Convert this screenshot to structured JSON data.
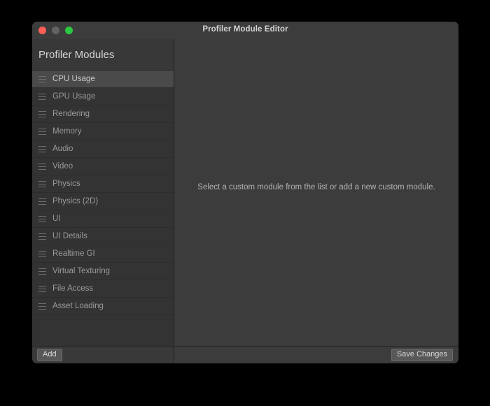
{
  "window": {
    "title": "Profiler Module Editor",
    "traffic_lights": [
      {
        "name": "close",
        "color": "#ff5f57"
      },
      {
        "name": "minimize",
        "color": "#636363"
      },
      {
        "name": "zoom",
        "color": "#28c840"
      }
    ]
  },
  "sidebar": {
    "header": "Profiler Modules",
    "selected_index": 0,
    "items": [
      {
        "label": "CPU Usage",
        "handle_icon": "drag-handle-icon",
        "selected": true
      },
      {
        "label": "GPU Usage",
        "handle_icon": "drag-handle-icon",
        "selected": false
      },
      {
        "label": "Rendering",
        "handle_icon": "drag-handle-icon",
        "selected": false
      },
      {
        "label": "Memory",
        "handle_icon": "drag-handle-icon",
        "selected": false
      },
      {
        "label": "Audio",
        "handle_icon": "drag-handle-icon",
        "selected": false
      },
      {
        "label": "Video",
        "handle_icon": "drag-handle-icon",
        "selected": false
      },
      {
        "label": "Physics",
        "handle_icon": "drag-handle-icon",
        "selected": false
      },
      {
        "label": "Physics (2D)",
        "handle_icon": "drag-handle-icon",
        "selected": false
      },
      {
        "label": "UI",
        "handle_icon": "drag-handle-icon",
        "selected": false
      },
      {
        "label": "UI Details",
        "handle_icon": "drag-handle-icon",
        "selected": false
      },
      {
        "label": "Realtime GI",
        "handle_icon": "drag-handle-icon",
        "selected": false
      },
      {
        "label": "Virtual Texturing",
        "handle_icon": "drag-handle-icon",
        "selected": false
      },
      {
        "label": "File Access",
        "handle_icon": "drag-handle-icon",
        "selected": false
      },
      {
        "label": "Asset Loading",
        "handle_icon": "drag-handle-icon",
        "selected": false
      }
    ]
  },
  "main": {
    "empty_message": "Select a custom module from the list or add a new custom module."
  },
  "footer": {
    "add_label": "Add",
    "save_label": "Save Changes"
  },
  "colors": {
    "window_bg": "#3c3c3c",
    "sidebar_bg": "#333333",
    "sidebar_header_bg": "#383838",
    "row_selected_bg": "#4a4a4a",
    "row_divider": "#2d2d2d",
    "text_primary": "#d6d6d6",
    "text_secondary": "#9a9a9a",
    "button_bg": "#585858",
    "desktop_bg": "#000000"
  }
}
